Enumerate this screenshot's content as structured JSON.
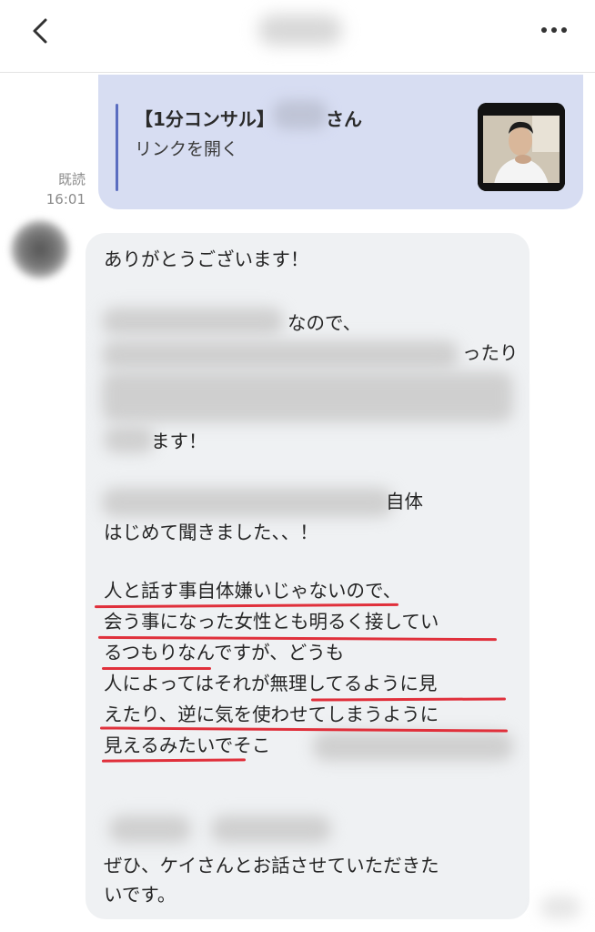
{
  "header": {
    "back_icon": "chevron-left-icon",
    "more_icon": "more-horizontal-icon"
  },
  "link_card": {
    "title_prefix": "【1分コンサル】",
    "title_suffix": "さん",
    "link_label": "リンクを開く"
  },
  "read_status": {
    "label": "既読",
    "time": "16:01"
  },
  "message": {
    "lines": [
      "ありがとうございます！",
      "なので、",
      "ったり",
      "ます！",
      "自体",
      "はじめて聞きました、、！",
      "人と話す事自体嫌いじゃないので、",
      "会う事になった女性とも明るく接してい",
      "るつもりなんですが、どうも",
      "人によってはそれが無理してるように見",
      "えたり、逆に気を使わせてしまうように",
      "見えるみたいでそこ",
      "ぜひ、ケイさんとお話させていただきた",
      "いです。"
    ]
  }
}
